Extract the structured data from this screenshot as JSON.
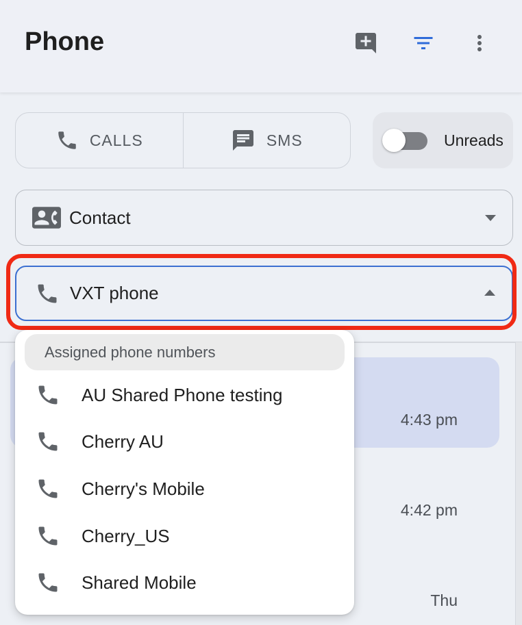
{
  "header": {
    "title": "Phone",
    "actions": [
      {
        "icon": "add-comment-icon"
      },
      {
        "icon": "filter-icon",
        "color": "#2f6bd9"
      },
      {
        "icon": "more-vert-icon"
      }
    ]
  },
  "tabs": {
    "calls_label": "CALLS",
    "sms_label": "SMS"
  },
  "unreads": {
    "label": "Unreads",
    "enabled": false
  },
  "contact_filter": {
    "label": "Contact",
    "icon": "contact-card-icon"
  },
  "phone_filter": {
    "label": "VXT phone",
    "icon": "phone-icon",
    "expanded": true,
    "focus_color": "#3b6fd1"
  },
  "dropdown_menu": {
    "section_header": "Assigned phone numbers",
    "items": [
      {
        "label": "AU Shared Phone testing"
      },
      {
        "label": "Cherry AU"
      },
      {
        "label": "Cherry's Mobile"
      },
      {
        "label": "Cherry_US"
      },
      {
        "label": "Shared Mobile"
      }
    ]
  },
  "conversation_list": {
    "times": [
      "4:43 pm",
      "4:42 pm",
      "Thu"
    ]
  },
  "colors": {
    "highlight": "#f02a15",
    "selected_row": "#d4dbf1",
    "accent": "#2f6bd9"
  }
}
